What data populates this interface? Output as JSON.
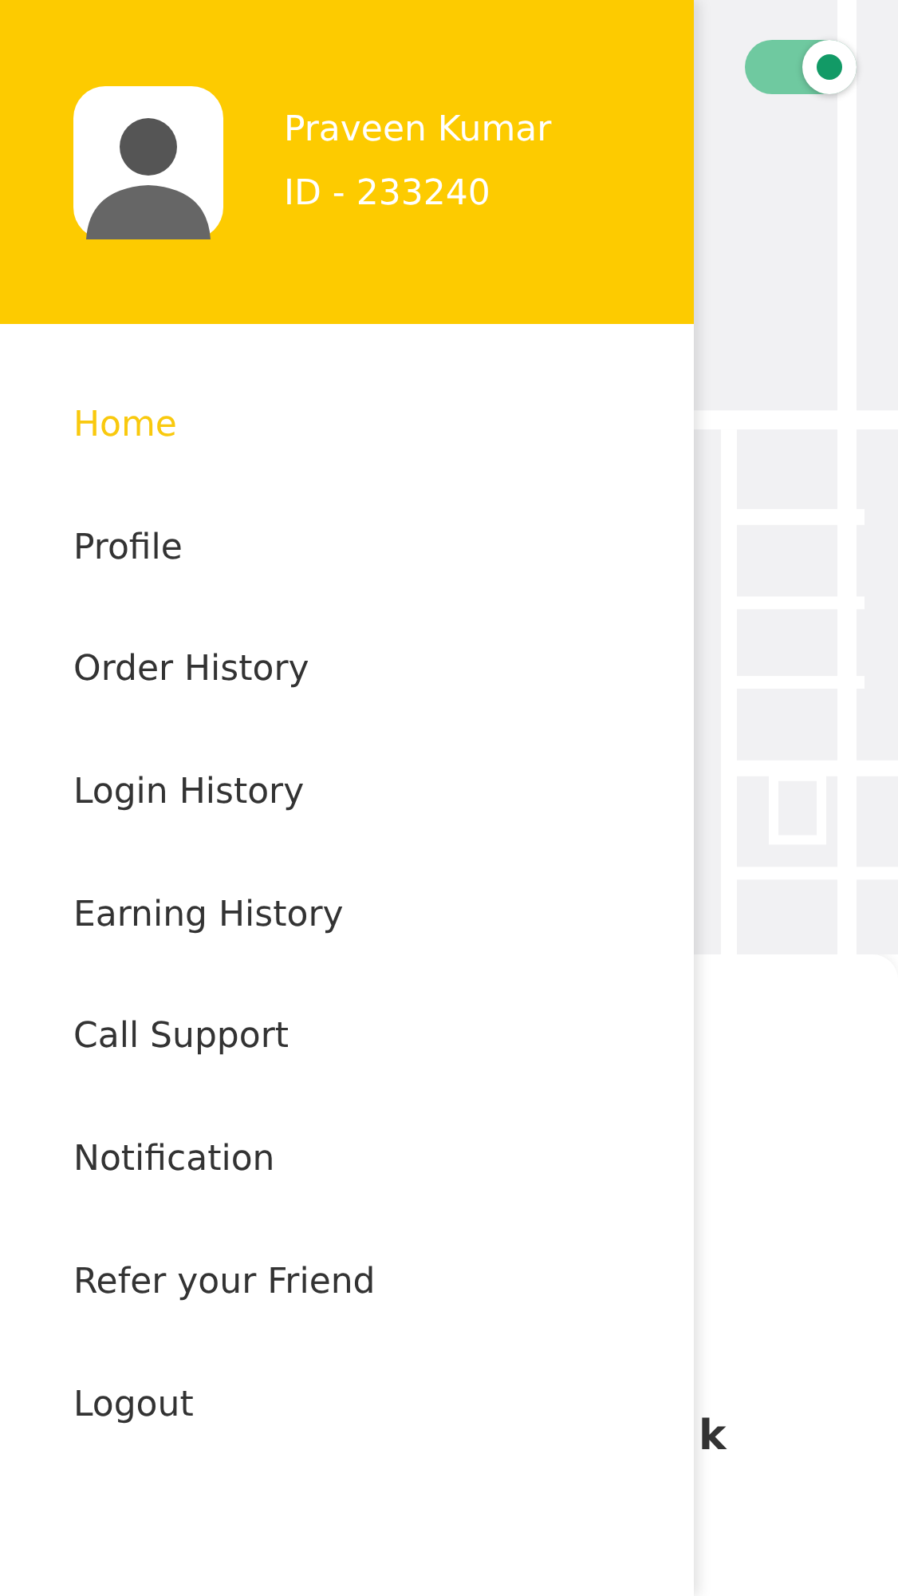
{
  "profile": {
    "name": "Praveen Kumar",
    "id": "ID - 233240"
  },
  "availability_toggle": {
    "on": true
  },
  "menu": [
    {
      "label": "Home",
      "selected": true
    },
    {
      "label": "Profile",
      "selected": false
    },
    {
      "label": "Order History",
      "selected": false
    },
    {
      "label": "Login History",
      "selected": false
    },
    {
      "label": "Earning History",
      "selected": false
    },
    {
      "label": "Call Support",
      "selected": false
    },
    {
      "label": "Notification",
      "selected": false
    },
    {
      "label": "Refer your Friend",
      "selected": false
    },
    {
      "label": "Logout",
      "selected": false
    }
  ],
  "background_card": {
    "text": "k"
  }
}
